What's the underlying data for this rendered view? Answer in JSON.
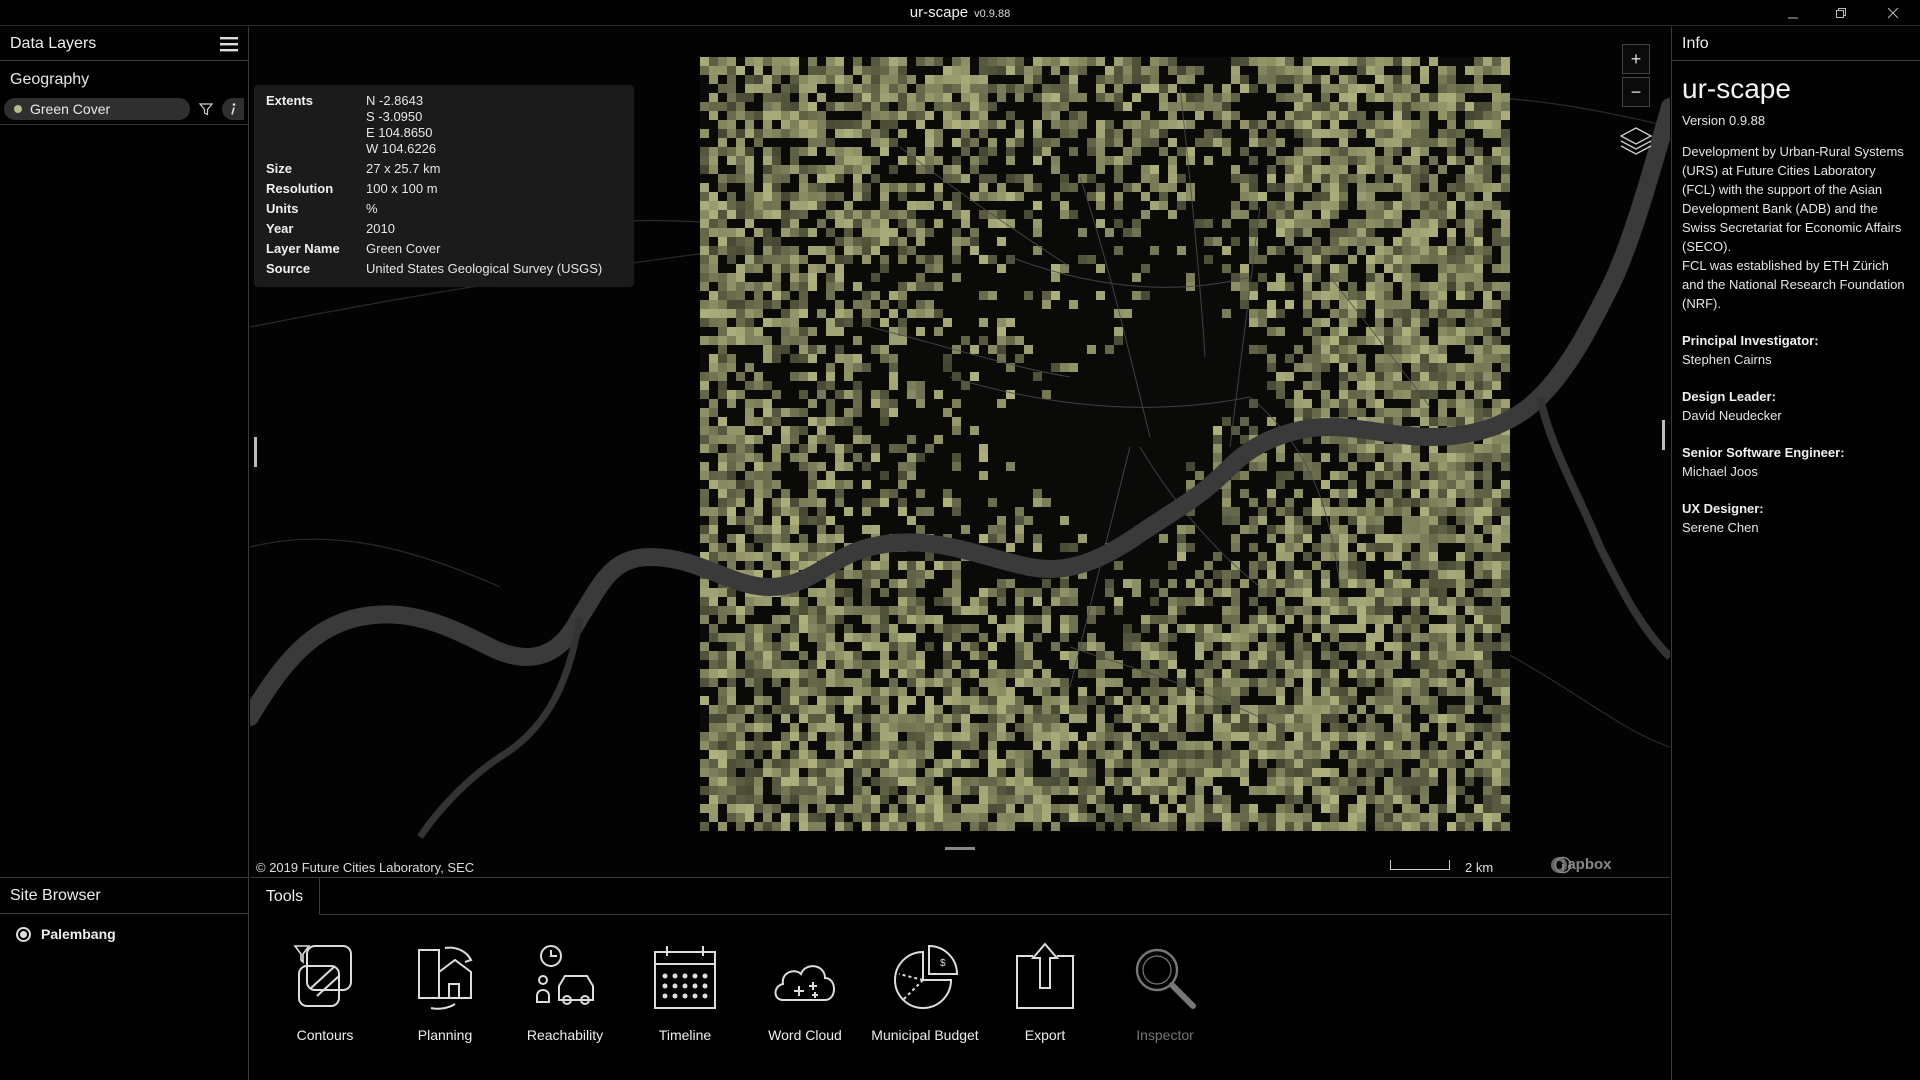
{
  "window": {
    "title": "ur-scape",
    "version_tag": "v0.9.88"
  },
  "data_layers": {
    "header": "Data Layers",
    "group": "Geography",
    "layer": {
      "name": "Green Cover",
      "color": "#b8bb84"
    }
  },
  "layer_info": {
    "extents_label": "Extents",
    "extents": {
      "n": "N  -2.8643",
      "s": "S  -3.0950",
      "e": "E  104.8650",
      "w": "W  104.6226"
    },
    "rows": [
      {
        "key": "Size",
        "value": "27 x 25.7 km"
      },
      {
        "key": "Resolution",
        "value": "100 x 100 m"
      },
      {
        "key": "Units",
        "value": "%"
      },
      {
        "key": "Year",
        "value": "2010"
      },
      {
        "key": "Layer Name",
        "value": "Green Cover"
      },
      {
        "key": "Source",
        "value": "United States Geological Survey (USGS)"
      }
    ]
  },
  "map": {
    "copyright": "© 2019 Future Cities Laboratory, SEC",
    "scale_label": "2 km",
    "attribution": "mapbox",
    "zoom_in": "+",
    "zoom_out": "−",
    "layer_color": "#b8bb84",
    "river_color": "#3a3a3a"
  },
  "info_panel": {
    "header": "Info",
    "app_name": "ur-scape",
    "version": "Version 0.9.88",
    "description": "Development by Urban-Rural Systems (URS) at Future Cities Laboratory (FCL) with the support of the Asian Development Bank (ADB) and the Swiss Secretariat for Economic Affairs (SECO).",
    "description2": "FCL was established by ETH Zürich and the National Research Foundation (NRF).",
    "credits": [
      {
        "role": "Principal Investigator:",
        "name": "Stephen Cairns"
      },
      {
        "role": "Design Leader:",
        "name": "David Neudecker"
      },
      {
        "role": "Senior Software Engineer:",
        "name": "Michael Joos"
      },
      {
        "role": "UX Designer:",
        "name": "Serene Chen"
      }
    ]
  },
  "site_browser": {
    "header": "Site Browser",
    "site": "Palembang"
  },
  "tools": {
    "tab": "Tools",
    "items": [
      {
        "label": "Contours",
        "icon": "contours-icon"
      },
      {
        "label": "Planning",
        "icon": "planning-icon"
      },
      {
        "label": "Reachability",
        "icon": "reachability-icon"
      },
      {
        "label": "Timeline",
        "icon": "timeline-icon"
      },
      {
        "label": "Word Cloud",
        "icon": "word-cloud-icon"
      },
      {
        "label": "Municipal Budget",
        "icon": "municipal-budget-icon"
      },
      {
        "label": "Export",
        "icon": "export-icon"
      },
      {
        "label": "Inspector",
        "icon": "inspector-icon",
        "disabled": true
      }
    ]
  }
}
